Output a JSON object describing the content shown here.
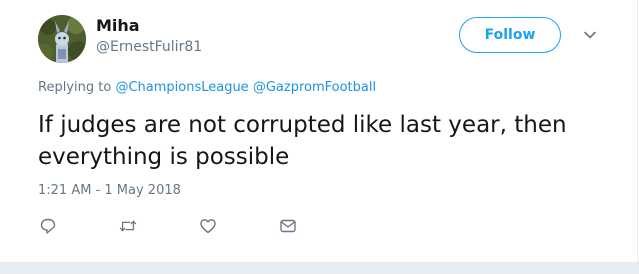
{
  "user": {
    "display_name": "Miha",
    "handle": "@ErnestFulir81"
  },
  "follow_label": "Follow",
  "reply_context": {
    "prefix": "Replying to",
    "mentions": [
      "@ChampionsLeague",
      "@GazpromFootball"
    ]
  },
  "tweet": {
    "text": "If judges are not corrupted like last year, then everything is possible",
    "timestamp": "1:21 AM - 1 May 2018"
  },
  "actions": [
    {
      "icon": "reply-icon"
    },
    {
      "icon": "retweet-icon"
    },
    {
      "icon": "like-icon"
    },
    {
      "icon": "direct-message-icon"
    }
  ],
  "colors": {
    "accent": "#1da1f2",
    "mention": "#1b95e0",
    "secondary_text": "#657786",
    "primary_text": "#14171a"
  }
}
